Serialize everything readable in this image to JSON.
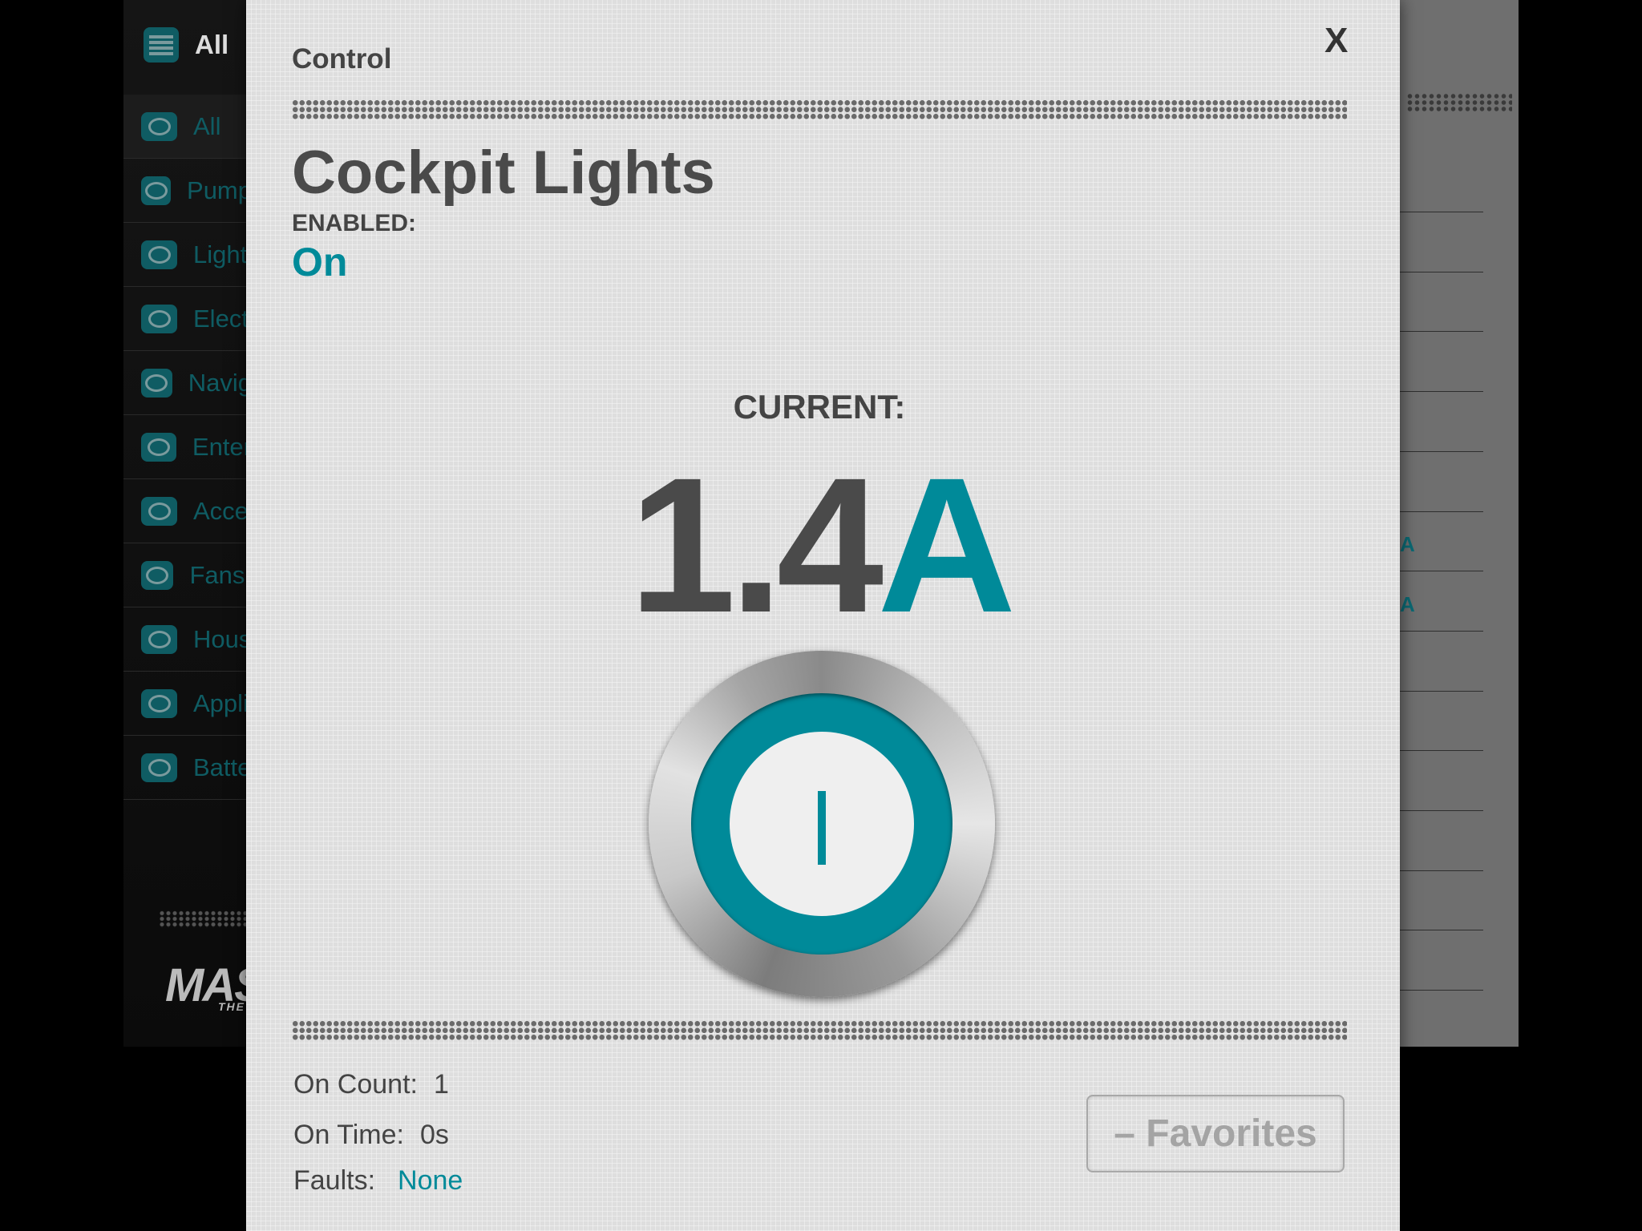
{
  "sidebar": {
    "header": "All",
    "items": [
      {
        "label": "All",
        "selected": true
      },
      {
        "label": "Pump"
      },
      {
        "label": "Light"
      },
      {
        "label": "Elect"
      },
      {
        "label": "Navig"
      },
      {
        "label": "Enter"
      },
      {
        "label": "Acce"
      },
      {
        "label": "Fans,"
      },
      {
        "label": "Hous"
      },
      {
        "label": "Appli"
      },
      {
        "label": "Batte"
      }
    ],
    "logo": "MAS",
    "logo_sub": "THE"
  },
  "right_panel": {
    "units": [
      "A",
      "A"
    ]
  },
  "modal": {
    "title": "Control",
    "close_label": "X",
    "device_name": "Cockpit Lights",
    "enabled_label": "ENABLED:",
    "enabled_value": "On",
    "current_label": "CURRENT:",
    "current_value": "1.4",
    "current_unit": "A",
    "power_state": "on",
    "stats": {
      "on_count_label": "On Count:",
      "on_count_value": "1",
      "on_time_label": "On Time:",
      "on_time_value": "0s",
      "faults_label": "Faults:",
      "faults_value": "None"
    },
    "favorites_button": "– Favorites"
  },
  "colors": {
    "accent": "#008a99",
    "text": "#4a4a4a"
  }
}
